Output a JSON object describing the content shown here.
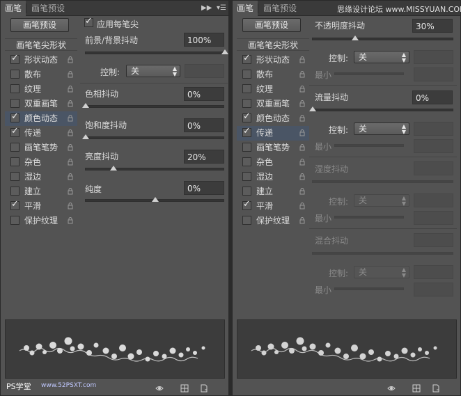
{
  "watermark": {
    "text": "思缘设计论坛  www.MISSYUAN.COM"
  },
  "bottom_watermark": {
    "ps": "PS学堂",
    "url": "www.52PSXT.com"
  },
  "panels": [
    {
      "tabs": [
        "画笔",
        "画笔预设"
      ],
      "preset_button": "画笔预设",
      "list_header": "画笔笔尖形状",
      "list_items": [
        {
          "label": "形状动态",
          "checked": true,
          "selected": false
        },
        {
          "label": "散布",
          "checked": false,
          "selected": false
        },
        {
          "label": "纹理",
          "checked": false,
          "selected": false
        },
        {
          "label": "双重画笔",
          "checked": false,
          "selected": false
        },
        {
          "label": "颜色动态",
          "checked": true,
          "selected": true
        },
        {
          "label": "传递",
          "checked": true,
          "selected": false
        },
        {
          "label": "画笔笔势",
          "checked": false,
          "selected": false
        },
        {
          "label": "杂色",
          "checked": false,
          "selected": false
        },
        {
          "label": "湿边",
          "checked": false,
          "selected": false
        },
        {
          "label": "建立",
          "checked": false,
          "selected": false
        },
        {
          "label": "平滑",
          "checked": true,
          "selected": false
        },
        {
          "label": "保护纹理",
          "checked": false,
          "selected": false
        }
      ],
      "apply_per_tip": "应用每笔尖",
      "fg_bg_jitter": "前景/背景抖动",
      "fg_bg_value": "100%",
      "fg_bg_level": 100,
      "control_label": "控制:",
      "control_value": "关",
      "hue_jitter": "色相抖动",
      "hue_value": "0%",
      "hue_level": 0,
      "saturation_jitter": "饱和度抖动",
      "saturation_value": "0%",
      "saturation_level": 0,
      "brightness_jitter": "亮度抖动",
      "brightness_value": "20%",
      "brightness_level": 20,
      "purity": "纯度",
      "purity_value": "0%",
      "purity_level": 50
    },
    {
      "tabs": [
        "画笔",
        "画笔预设"
      ],
      "preset_button": "画笔预设",
      "list_header": "画笔笔尖形状",
      "list_items": [
        {
          "label": "形状动态",
          "checked": true,
          "selected": false
        },
        {
          "label": "散布",
          "checked": false,
          "selected": false
        },
        {
          "label": "纹理",
          "checked": false,
          "selected": false
        },
        {
          "label": "双重画笔",
          "checked": false,
          "selected": false
        },
        {
          "label": "颜色动态",
          "checked": true,
          "selected": false
        },
        {
          "label": "传递",
          "checked": true,
          "selected": true
        },
        {
          "label": "画笔笔势",
          "checked": false,
          "selected": false
        },
        {
          "label": "杂色",
          "checked": false,
          "selected": false
        },
        {
          "label": "湿边",
          "checked": false,
          "selected": false
        },
        {
          "label": "建立",
          "checked": false,
          "selected": false
        },
        {
          "label": "平滑",
          "checked": true,
          "selected": false
        },
        {
          "label": "保护纹理",
          "checked": false,
          "selected": false
        }
      ],
      "opacity_jitter": "不透明度抖动",
      "opacity_value": "30%",
      "opacity_level": 30,
      "control_label": "控制:",
      "control_value": "关",
      "minimum_label": "最小",
      "flow_jitter": "流量抖动",
      "flow_value": "0%",
      "flow_level": 0,
      "wetness_jitter": "湿度抖动",
      "mix_jitter": "混合抖动"
    }
  ],
  "colors": {
    "panel_bg": "#535353",
    "selected_row": "#4a5565",
    "field_bg": "#3c3c3c"
  }
}
